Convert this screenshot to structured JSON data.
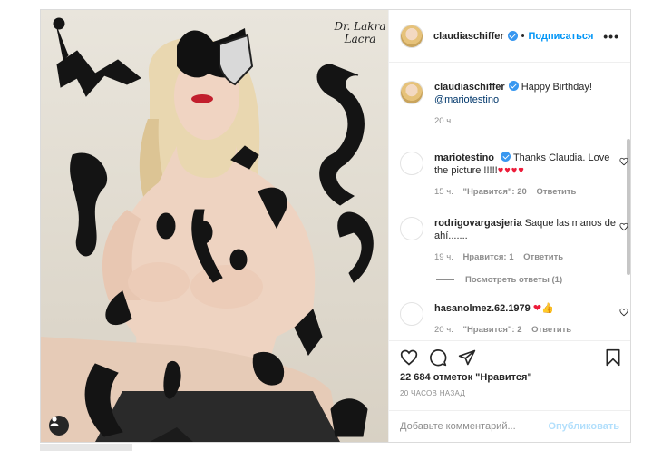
{
  "post": {
    "username": "claudiaschiffer",
    "follow_label": "Подписаться",
    "separator": "•",
    "more_label": "•••"
  },
  "caption": {
    "username": "claudiaschiffer",
    "text": "Happy Birthday!",
    "mention": "@mariotestino",
    "time": "20 ч."
  },
  "comments": [
    {
      "username": "mariotestino",
      "text": "Thanks Claudia. Love the picture !!!!!",
      "emoji": "♥♥♥♥",
      "time": "15 ч.",
      "likes": "\"Нравится\": 20",
      "reply": "Ответить"
    },
    {
      "username": "rodrigovargasjeria",
      "text": "Saque las manos de ahí.......",
      "time": "19 ч.",
      "likes": "Нравится: 1",
      "reply": "Ответить",
      "show_replies": "Посмотреть ответы (1)"
    },
    {
      "username": "hasanolmez.62.1979",
      "emoji": "❤👍",
      "time": "20 ч.",
      "likes": "\"Нравится\": 2",
      "reply": "Ответить"
    }
  ],
  "likes_count": "22 684 отметок \"Нравится\"",
  "post_time": "20 ЧАСОВ НАЗАД",
  "add_comment_placeholder": "Добавьте комментарий...",
  "publish_label": "Опубликовать",
  "image_signature": "Dr. Lakra",
  "icons": [
    "user-tag-icon",
    "verified-icon",
    "more-icon",
    "heart-icon",
    "comment-icon",
    "share-icon",
    "bookmark-icon"
  ],
  "colors": {
    "accent": "#0095f6",
    "verified": "#3897f0",
    "heart": "#ed1c3a",
    "publish_disabled": "#b2dffc"
  }
}
